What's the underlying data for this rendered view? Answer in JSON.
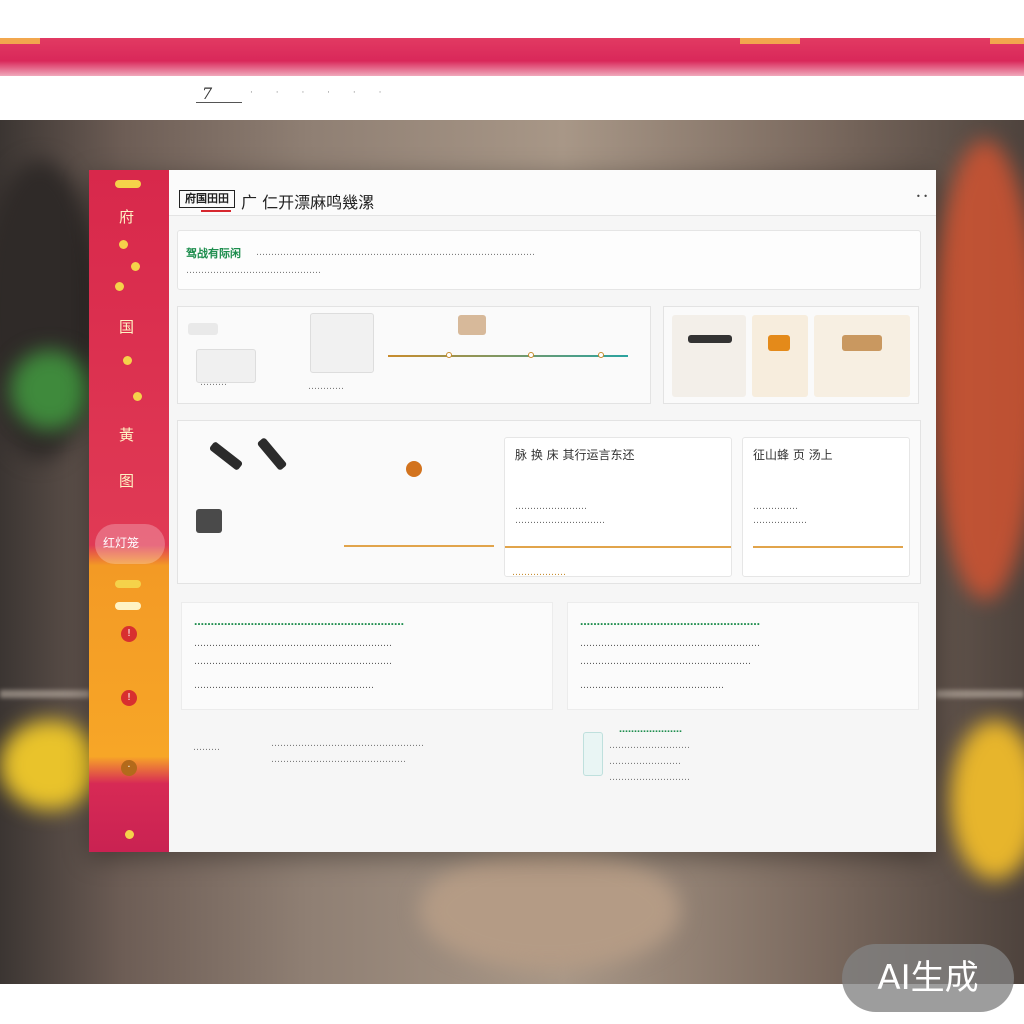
{
  "browser": {
    "address_number": "7",
    "address_items": "· · · · · ·"
  },
  "colors": {
    "accent_red": "#d8284b",
    "accent_orange": "#f7a627",
    "accent_green": "#1e8e4e",
    "accent_yellow": "#f5d24a"
  },
  "app": {
    "logo_text": "府国田田",
    "title": "广 仁开漂麻鸣幾漯",
    "window_controls": "• •"
  },
  "sidebar": {
    "glyphs": [
      "府",
      "国",
      "黃",
      "图"
    ],
    "badge": "红灯笼",
    "alert_icons": [
      "!",
      "!",
      "·"
    ]
  },
  "intro": {
    "heading": "驾战有际闲",
    "body_line1": "…………………………………………………………………………………",
    "body_line2": "………………………………………"
  },
  "workflow": {
    "left_caption": "………",
    "mid_caption": "…………"
  },
  "detail_cards": {
    "a": {
      "title": "脉 换 床 其行运言东还",
      "line1": "……………………",
      "line2": "…………………………"
    },
    "b": {
      "title": "征山蜂 页 汤上",
      "line1": "……………",
      "line2": "………………"
    },
    "footer": "………………"
  },
  "text_blocks": {
    "left": {
      "heading": "………………………………………………………",
      "line1": "…………………………………………………………",
      "line2": "…………………………………………………………",
      "line3": "……………………………………………………"
    },
    "right": {
      "heading": "………………………………………………",
      "line1": "……………………………………………………",
      "line2": "…………………………………………………",
      "line3": "…………………………………………"
    }
  },
  "footer": {
    "label": "………",
    "line1": "……………………………………………",
    "line2": "………………………………………",
    "list_title": "…………………",
    "items": [
      "………………………",
      "……………………",
      "………………………"
    ]
  },
  "watermark": "AI生成"
}
